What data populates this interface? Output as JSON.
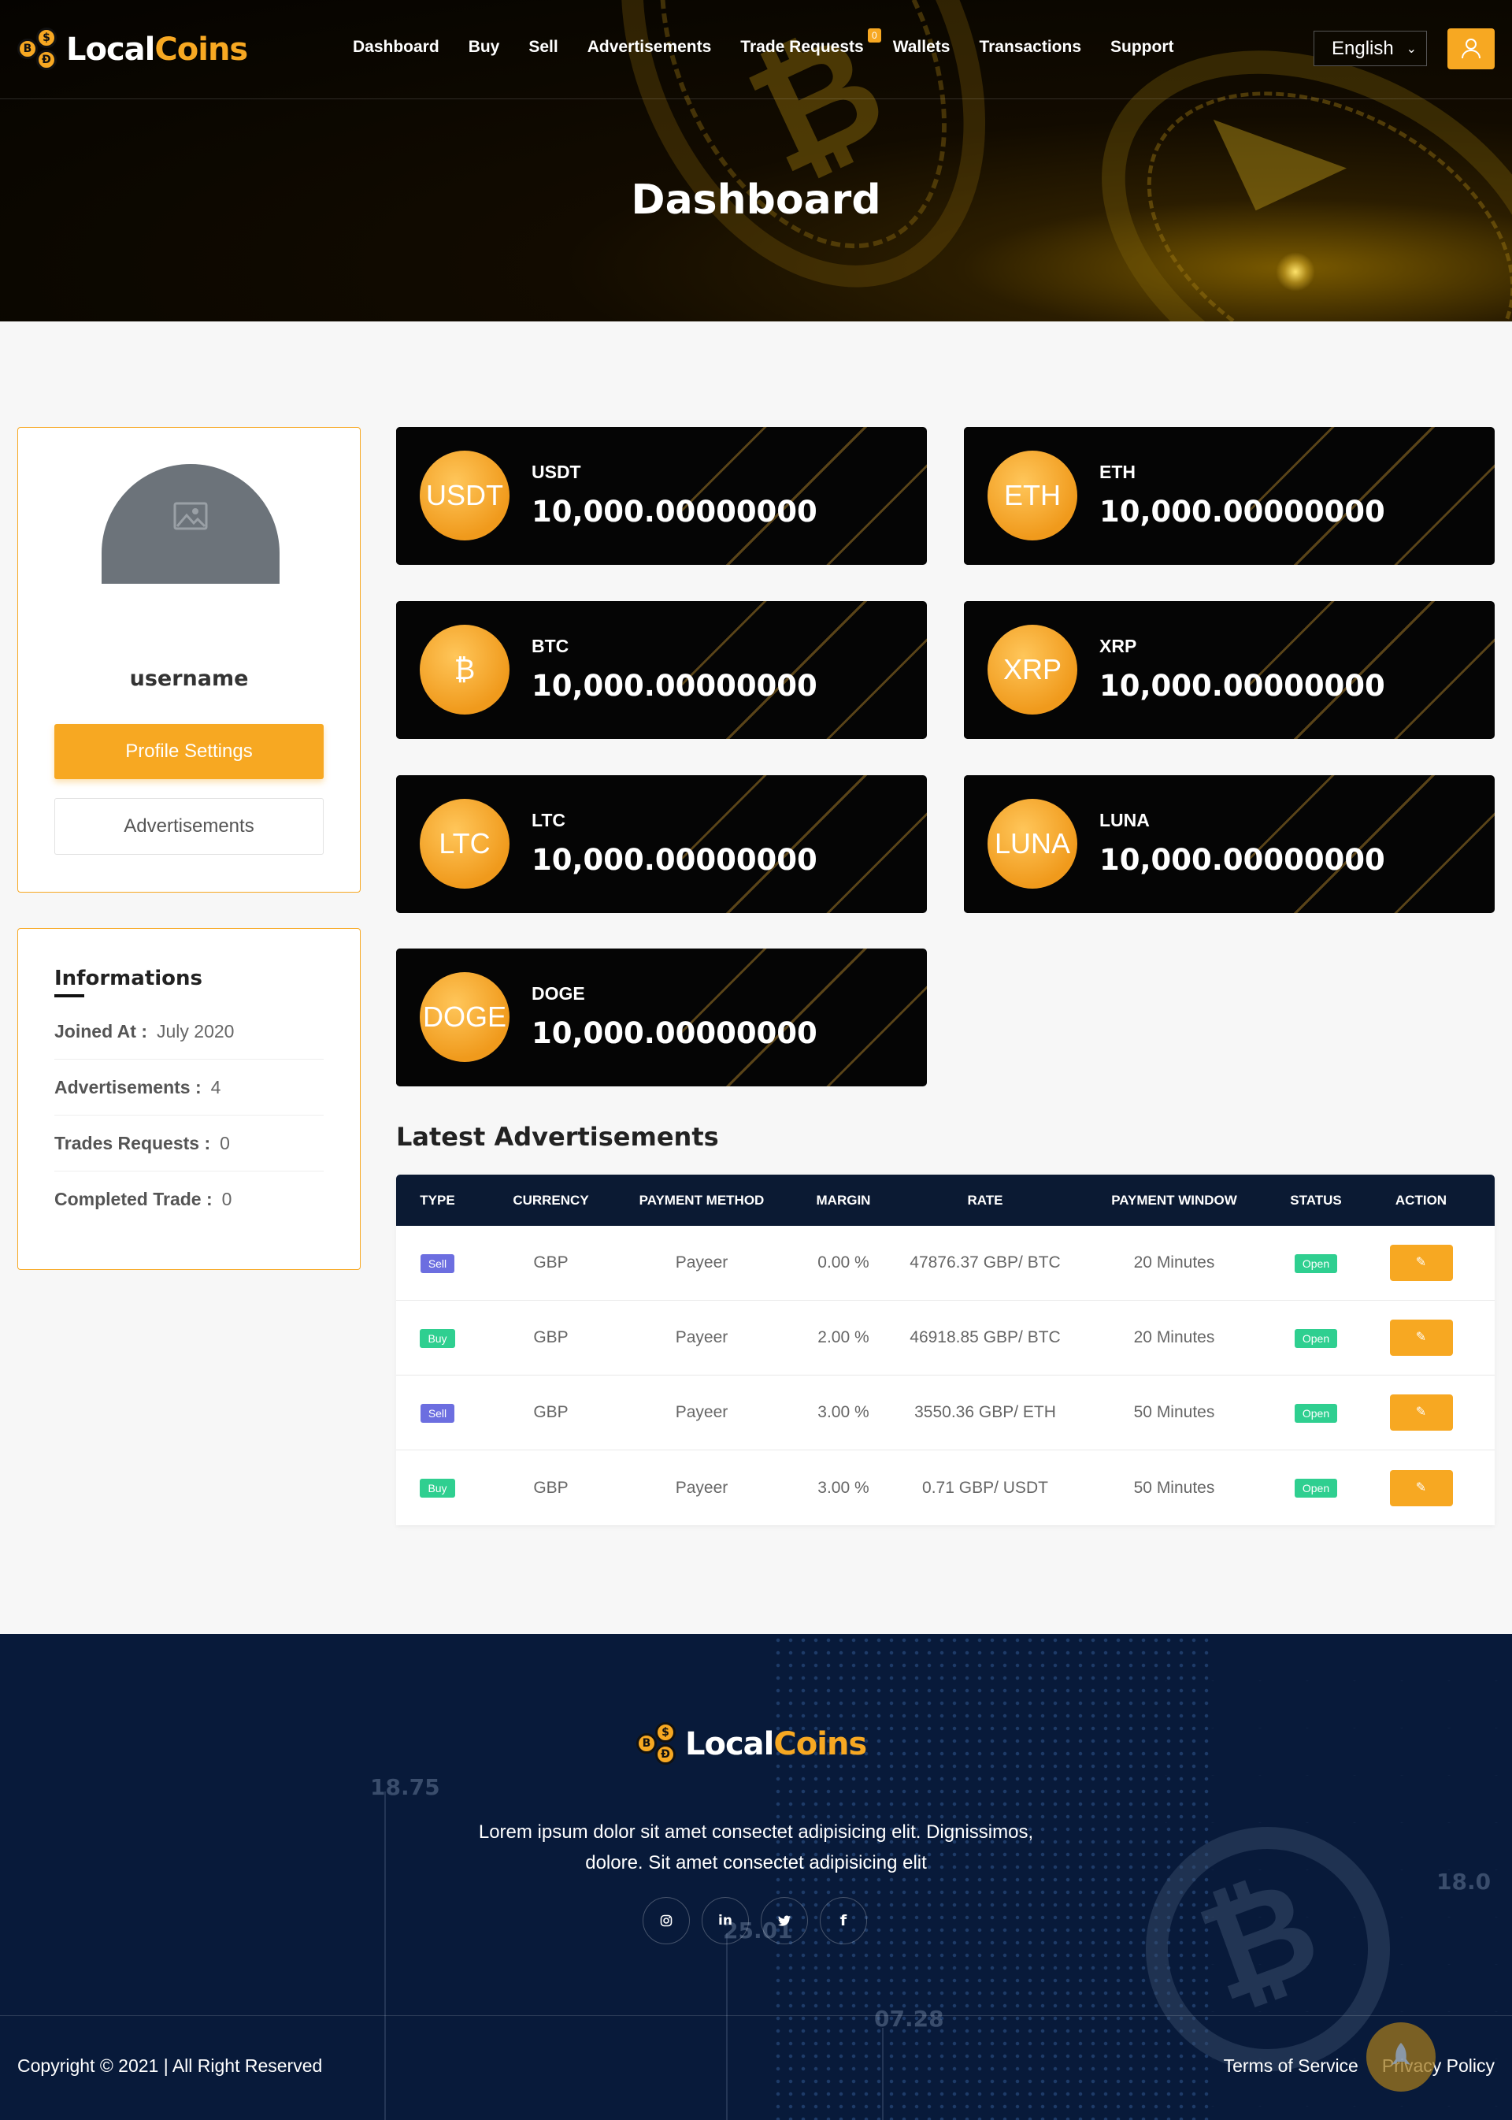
{
  "brand": {
    "name_part1": "Local",
    "name_part2": "Coins"
  },
  "nav": {
    "items": [
      "Dashboard",
      "Buy",
      "Sell",
      "Advertisements",
      "Trade Requests",
      "Wallets",
      "Transactions",
      "Support"
    ],
    "trade_requests_badge": "0",
    "language": "English"
  },
  "hero": {
    "title": "Dashboard"
  },
  "profile": {
    "username": "username",
    "profile_settings_label": "Profile Settings",
    "advertisements_label": "Advertisements"
  },
  "info": {
    "title": "Informations",
    "rows": [
      {
        "label": "Joined At :",
        "value": "July 2020"
      },
      {
        "label": "Advertisements :",
        "value": "4"
      },
      {
        "label": "Trades Requests :",
        "value": "0"
      },
      {
        "label": "Completed Trade  :",
        "value": "0"
      }
    ]
  },
  "balances": [
    {
      "coin_label": "USDT",
      "name": "USDT",
      "amount": "10,000.00000000"
    },
    {
      "coin_label": "ETH",
      "name": "ETH",
      "amount": "10,000.00000000"
    },
    {
      "coin_label": "₿",
      "name": "BTC",
      "amount": "10,000.00000000"
    },
    {
      "coin_label": "XRP",
      "name": "XRP",
      "amount": "10,000.00000000"
    },
    {
      "coin_label": "LTC",
      "name": "LTC",
      "amount": "10,000.00000000"
    },
    {
      "coin_label": "LUNA",
      "name": "LUNA",
      "amount": "10,000.00000000"
    },
    {
      "coin_label": "DOGE",
      "name": "DOGE",
      "amount": "10,000.00000000"
    }
  ],
  "latest": {
    "title": "Latest Advertisements",
    "headers": [
      "TYPE",
      "CURRENCY",
      "PAYMENT METHOD",
      "MARGIN",
      "RATE",
      "PAYMENT WINDOW",
      "STATUS",
      "ACTION"
    ],
    "rows": [
      {
        "type": "Sell",
        "currency": "GBP",
        "method": "Payeer",
        "margin": "0.00 %",
        "rate": "47876.37 GBP/ BTC",
        "window": "20 Minutes",
        "status": "Open"
      },
      {
        "type": "Buy",
        "currency": "GBP",
        "method": "Payeer",
        "margin": "2.00 %",
        "rate": "46918.85 GBP/ BTC",
        "window": "20 Minutes",
        "status": "Open"
      },
      {
        "type": "Sell",
        "currency": "GBP",
        "method": "Payeer",
        "margin": "3.00 %",
        "rate": "3550.36 GBP/ ETH",
        "window": "50 Minutes",
        "status": "Open"
      },
      {
        "type": "Buy",
        "currency": "GBP",
        "method": "Payeer",
        "margin": "3.00 %",
        "rate": "0.71 GBP/ USDT",
        "window": "50 Minutes",
        "status": "Open"
      }
    ]
  },
  "footer": {
    "description_line1": "Lorem ipsum dolor sit amet consectet adipisicing elit. Dignissimos,",
    "description_line2": "dolore. Sit amet consectet adipisicing elit",
    "tickers": [
      "18.75",
      "25.01",
      "07.28",
      "18.0"
    ],
    "copyright": "Copyright © 2021 | All Right Reserved",
    "links": [
      "Terms of Service",
      "Privacy Policy"
    ]
  },
  "colors": {
    "accent": "#f7a822",
    "dark": "#050505",
    "table_header": "#0b1a33",
    "footer_bg": "#081a3a",
    "sell": "#6c6ee0",
    "buy": "#2fcf90"
  }
}
